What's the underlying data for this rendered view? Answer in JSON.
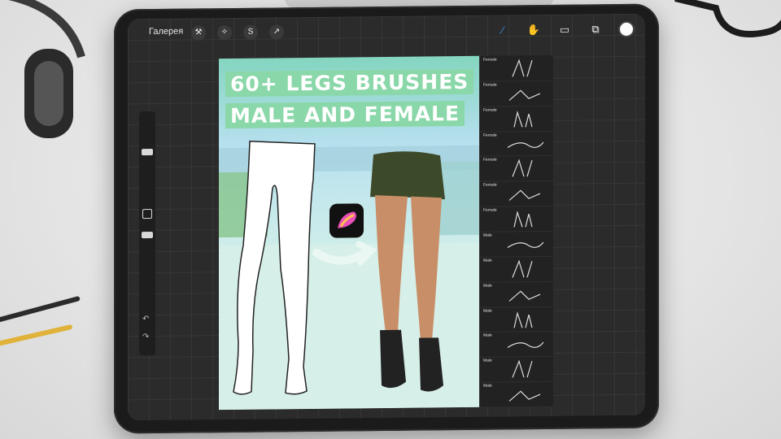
{
  "topbar": {
    "gallery_label": "Галерея",
    "left_tools": [
      "wrench-icon",
      "magic-wand-icon",
      "selection-s-icon",
      "arrow-cursor-icon"
    ],
    "right_tools": [
      "brush-icon",
      "smudge-icon",
      "eraser-icon",
      "layers-icon"
    ],
    "active_tool": "brush-icon",
    "current_color": "#ffffff"
  },
  "artwork": {
    "title_line1": "60+ LEGS BRUSHES",
    "title_line2": "MALE AND FEMALE",
    "title_bg": "#8ad7a9"
  },
  "brush_panel": {
    "items": [
      {
        "label": "Female"
      },
      {
        "label": "Female"
      },
      {
        "label": "Female"
      },
      {
        "label": "Female"
      },
      {
        "label": "Female"
      },
      {
        "label": "Female"
      },
      {
        "label": "Female"
      },
      {
        "label": "Male"
      },
      {
        "label": "Male"
      },
      {
        "label": "Male"
      },
      {
        "label": "Male"
      },
      {
        "label": "Male"
      },
      {
        "label": "Male"
      },
      {
        "label": "Male"
      }
    ]
  },
  "colors": {
    "screen_bg": "#2b2b2b",
    "tablet_bezel": "#1b1b1b",
    "active_tool": "#3d8fe0"
  }
}
